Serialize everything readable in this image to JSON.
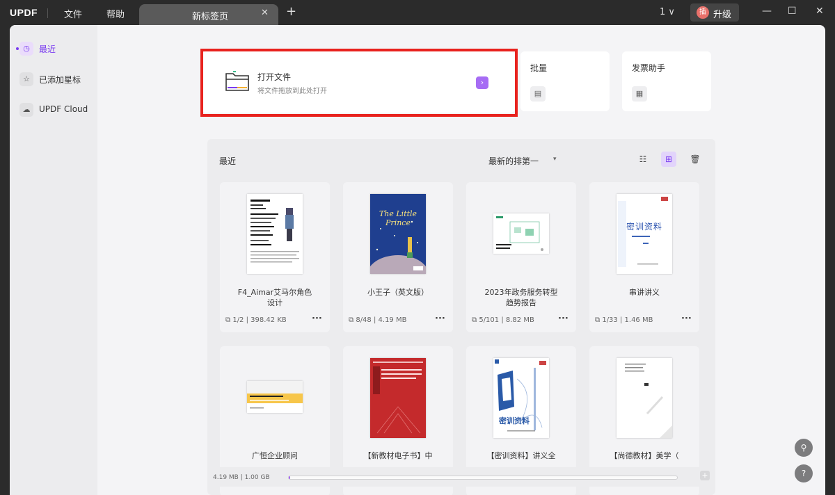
{
  "titlebar": {
    "logo": "UPDF",
    "menu": [
      "文件",
      "帮助"
    ],
    "tab_label": "新标签页",
    "tab_close": "✕",
    "tab_add": "+",
    "count": "1 ∨",
    "upgrade_avatar": "插",
    "upgrade_label": "升级",
    "minimize": "—",
    "maximize": "☐",
    "close": "✕"
  },
  "sidebar": {
    "items": [
      {
        "label": "最近",
        "icon": "clock-icon",
        "glyph": "◷",
        "active": true
      },
      {
        "label": "已添加星标",
        "icon": "star-icon",
        "glyph": "☆",
        "active": false
      },
      {
        "label": "UPDF Cloud",
        "icon": "cloud-icon",
        "glyph": "☁",
        "active": false
      }
    ]
  },
  "open_file": {
    "title": "打开文件",
    "subtitle": "将文件拖放到此处打开",
    "arrow": "›"
  },
  "quick_cards": [
    {
      "title": "批量",
      "icon": "batch-icon",
      "glyph": "▤"
    },
    {
      "title": "发票助手",
      "icon": "invoice-icon",
      "glyph": "▦"
    }
  ],
  "recent": {
    "title": "最近",
    "sort_label": "最新的排第一",
    "sort_caret": "▾",
    "list_view_glyph": "☷",
    "grid_view_glyph": "⊞",
    "trash_glyph": "🗑"
  },
  "files": [
    {
      "name_lines": [
        "F4_Aimar艾马尔角色",
        "设计"
      ],
      "pages": "1/2",
      "size": "398.42 KB",
      "thumb": "profile"
    },
    {
      "name_lines": [
        "小王子（英文版）"
      ],
      "pages": "8/48",
      "size": "4.19 MB",
      "thumb": "prince",
      "cover_text": "The Little Prince"
    },
    {
      "name_lines": [
        "2023年政务服务转型",
        "趋势报告"
      ],
      "pages": "5/101",
      "size": "8.82 MB",
      "thumb": "report"
    },
    {
      "name_lines": [
        "串讲讲义"
      ],
      "pages": "1/33",
      "size": "1.46 MB",
      "thumb": "lecture",
      "cover_text": "密训资料"
    },
    {
      "name_lines": [
        "广恒企业顾问"
      ],
      "pages": "",
      "size": "",
      "thumb": "consult"
    },
    {
      "name_lines": [
        "【新教材电子书】中"
      ],
      "pages": "",
      "size": "",
      "thumb": "redbook"
    },
    {
      "name_lines": [
        "【密训资料】讲义全"
      ],
      "pages": "",
      "size": "",
      "thumb": "bluebook",
      "cover_text": "密训资料"
    },
    {
      "name_lines": [
        "【尚德教材】美学（"
      ],
      "pages": "",
      "size": "",
      "thumb": "aesthetic"
    }
  ],
  "storage": {
    "label": "4.19 MB | 1.00 GB",
    "fraction": 0.004
  },
  "colors": {
    "accent": "#7a3cf0",
    "highlight_frame": "#e8221e"
  }
}
